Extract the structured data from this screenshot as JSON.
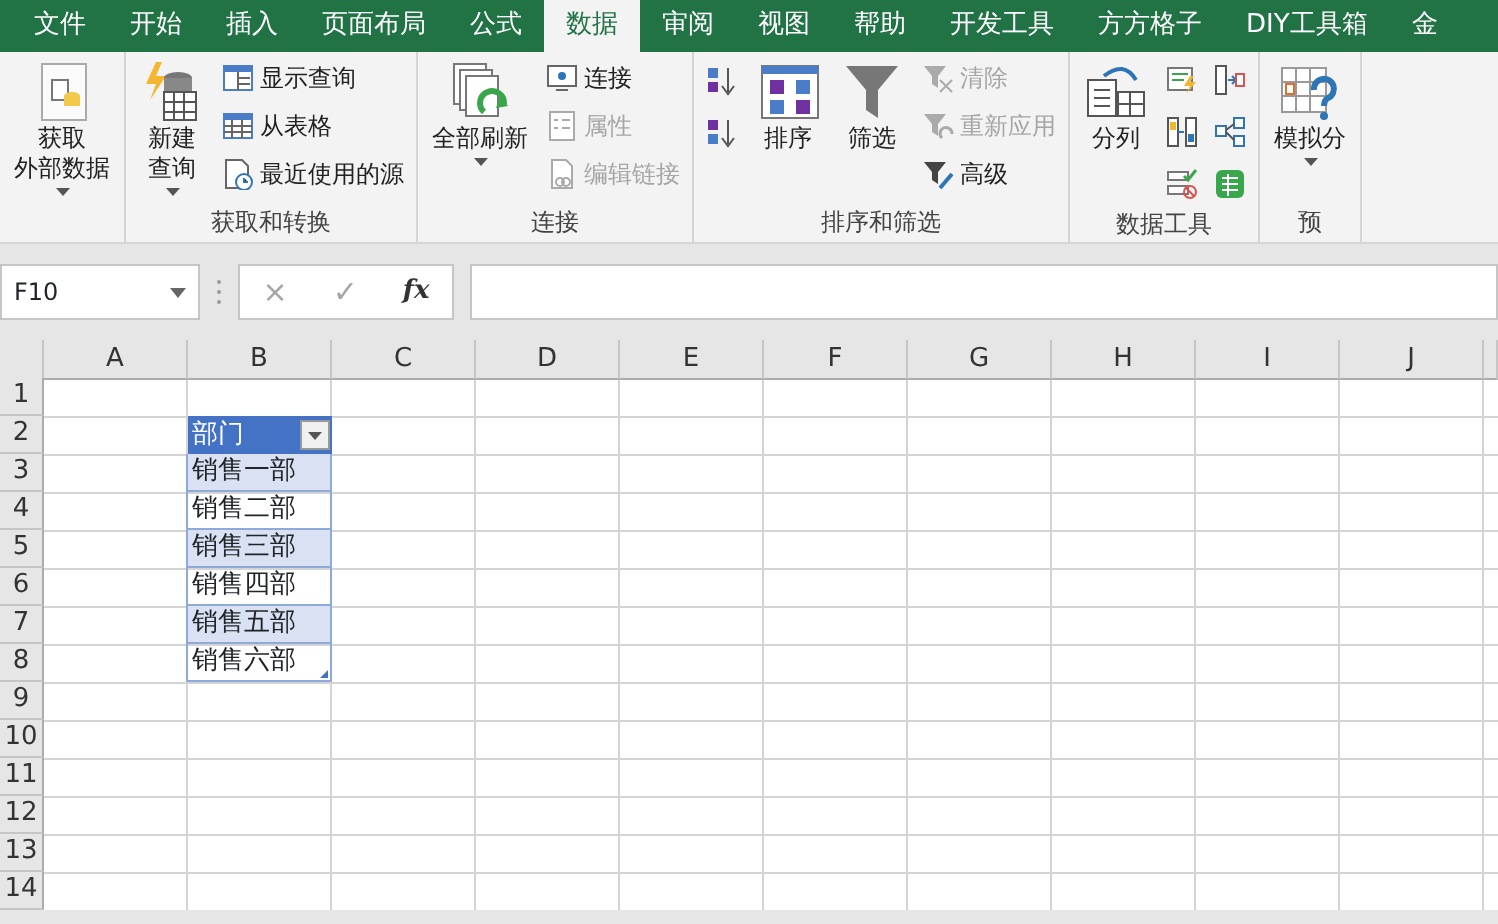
{
  "tabs": [
    {
      "label": "文件",
      "selected": false
    },
    {
      "label": "开始",
      "selected": false
    },
    {
      "label": "插入",
      "selected": false
    },
    {
      "label": "页面布局",
      "selected": false
    },
    {
      "label": "公式",
      "selected": false
    },
    {
      "label": "数据",
      "selected": true
    },
    {
      "label": "审阅",
      "selected": false
    },
    {
      "label": "视图",
      "selected": false
    },
    {
      "label": "帮助",
      "selected": false
    },
    {
      "label": "开发工具",
      "selected": false
    },
    {
      "label": "方方格子",
      "selected": false
    },
    {
      "label": "DIY工具箱",
      "selected": false
    },
    {
      "label": "金",
      "selected": false
    }
  ],
  "ribbon": {
    "groups": [
      {
        "columns": [
          [
            {
              "kind": "large",
              "lines": [
                "获取",
                "外部数据"
              ],
              "dropdown": true,
              "disabled": false
            }
          ]
        ]
      },
      {
        "label": "获取和转换",
        "columns": [
          [
            {
              "kind": "large",
              "lines": [
                "新建",
                "查询"
              ],
              "dropdown": true,
              "disabled": false
            }
          ],
          [
            {
              "kind": "small",
              "label": "显示查询",
              "disabled": false
            },
            {
              "kind": "small",
              "label": "从表格",
              "disabled": false
            },
            {
              "kind": "small",
              "label": "最近使用的源",
              "disabled": false
            }
          ]
        ]
      },
      {
        "label": "连接",
        "columns": [
          [
            {
              "kind": "large",
              "lines": [
                "全部刷新"
              ],
              "dropdown": true,
              "disabled": false
            }
          ],
          [
            {
              "kind": "small",
              "label": "连接",
              "disabled": false
            },
            {
              "kind": "small",
              "label": "属性",
              "disabled": true
            },
            {
              "kind": "small",
              "label": "编辑链接",
              "disabled": true
            }
          ]
        ]
      },
      {
        "label": "排序和筛选",
        "columns": [
          [
            {
              "kind": "icon"
            },
            {
              "kind": "icon"
            }
          ],
          [
            {
              "kind": "large",
              "lines": [
                "排序"
              ],
              "dropdown": false,
              "disabled": false
            }
          ],
          [
            {
              "kind": "large",
              "lines": [
                "筛选"
              ],
              "dropdown": false,
              "disabled": false
            }
          ],
          [
            {
              "kind": "small",
              "label": "清除",
              "disabled": true
            },
            {
              "kind": "small",
              "label": "重新应用",
              "disabled": true
            },
            {
              "kind": "small",
              "label": "高级",
              "disabled": false
            }
          ]
        ]
      },
      {
        "label": "数据工具",
        "columns": [
          [
            {
              "kind": "large",
              "lines": [
                "分列"
              ],
              "dropdown": false,
              "disabled": false
            }
          ],
          [
            {
              "kind": "icon"
            },
            {
              "kind": "icon"
            },
            {
              "kind": "icon"
            }
          ],
          [
            {
              "kind": "icon"
            },
            {
              "kind": "icon"
            },
            {
              "kind": "icon"
            }
          ]
        ]
      },
      {
        "label": "预",
        "columns": [
          [
            {
              "kind": "large",
              "lines": [
                "模拟分"
              ],
              "dropdown": true,
              "disabled": false
            }
          ]
        ]
      }
    ]
  },
  "formula_bar": {
    "name_box": "F10",
    "buttons": [
      {
        "label": "×",
        "disabled": true
      },
      {
        "label": "✓",
        "disabled": true
      },
      {
        "label": "fx",
        "disabled": false
      }
    ]
  },
  "sheet": {
    "columns": [
      "A",
      "B",
      "C",
      "D",
      "E",
      "F",
      "G",
      "H",
      "I",
      "J"
    ],
    "rows": [
      "1",
      "2",
      "3",
      "4",
      "5",
      "6",
      "7",
      "8",
      "9",
      "10",
      "11",
      "12",
      "13",
      "14"
    ],
    "table": {
      "header": "部门",
      "filter": true,
      "items": [
        "销售一部",
        "销售二部",
        "销售三部",
        "销售四部",
        "销售五部",
        "销售六部"
      ]
    }
  }
}
